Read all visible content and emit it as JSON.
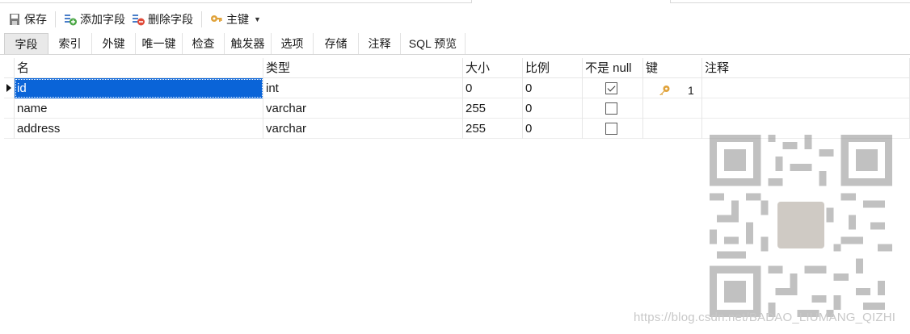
{
  "toolbar": {
    "save_label": "保存",
    "add_field_label": "添加字段",
    "delete_field_label": "删除字段",
    "primary_key_label": "主键"
  },
  "tabs": [
    {
      "label": "字段",
      "active": true
    },
    {
      "label": "索引"
    },
    {
      "label": "外键"
    },
    {
      "label": "唯一键"
    },
    {
      "label": "检查"
    },
    {
      "label": "触发器"
    },
    {
      "label": "选项"
    },
    {
      "label": "存储"
    },
    {
      "label": "注释"
    },
    {
      "label": "SQL 预览"
    }
  ],
  "columns": {
    "name": "名",
    "type": "类型",
    "size": "大小",
    "scale": "比例",
    "not_null": "不是 null",
    "key": "键",
    "comment": "注释"
  },
  "rows": [
    {
      "name": "id",
      "type": "int",
      "size": "0",
      "scale": "0",
      "not_null": true,
      "key": "1",
      "selected": true
    },
    {
      "name": "name",
      "type": "varchar",
      "size": "255",
      "scale": "0",
      "not_null": false,
      "key": ""
    },
    {
      "name": "address",
      "type": "varchar",
      "size": "255",
      "scale": "0",
      "not_null": false,
      "key": ""
    }
  ],
  "watermark": "https://blog.csdn.net/BADAO_LIUMANG_QIZHI",
  "colors": {
    "selection": "#0a64d8",
    "key_icon": "#e0a23a"
  }
}
